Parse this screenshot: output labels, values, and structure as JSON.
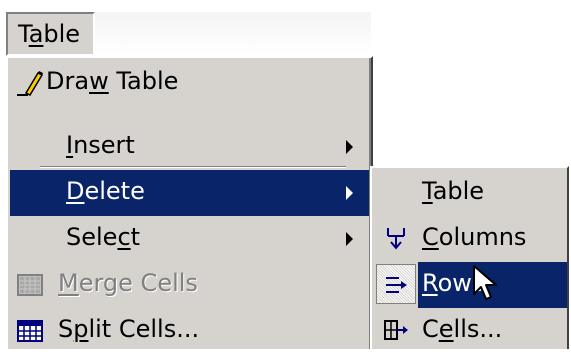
{
  "menubar": {
    "table_label_pre": "T",
    "table_label_u": "a",
    "table_label_post": "ble"
  },
  "menu": {
    "draw_table": {
      "pre": "Dra",
      "u": "w",
      "post": " Table",
      "icon": "pencil-icon"
    },
    "insert": {
      "pre": "",
      "u": "I",
      "post": "nsert"
    },
    "delete": {
      "pre": "",
      "u": "D",
      "post": "elete"
    },
    "select": {
      "pre": "Sele",
      "u": "c",
      "post": "t"
    },
    "merge_cells": {
      "pre": "",
      "u": "M",
      "post": "erge Cells",
      "icon": "merge-cells-icon",
      "disabled": true
    },
    "split_cells": {
      "pre": "S",
      "u": "p",
      "post": "lit Cells...",
      "icon": "split-cells-icon"
    }
  },
  "delete_submenu": {
    "table": {
      "pre": "",
      "u": "T",
      "post": "able"
    },
    "columns": {
      "pre": "",
      "u": "C",
      "post": "olumns",
      "icon": "delete-columns-icon"
    },
    "rows": {
      "pre": "",
      "u": "R",
      "post": "ows",
      "icon": "delete-rows-icon"
    },
    "cells": {
      "pre": "C",
      "u": "e",
      "post": "lls...",
      "icon": "delete-cells-icon"
    }
  },
  "colors": {
    "highlight": "#0a246a",
    "menu_bg": "#d6d3ce",
    "disabled_text": "#808080"
  }
}
